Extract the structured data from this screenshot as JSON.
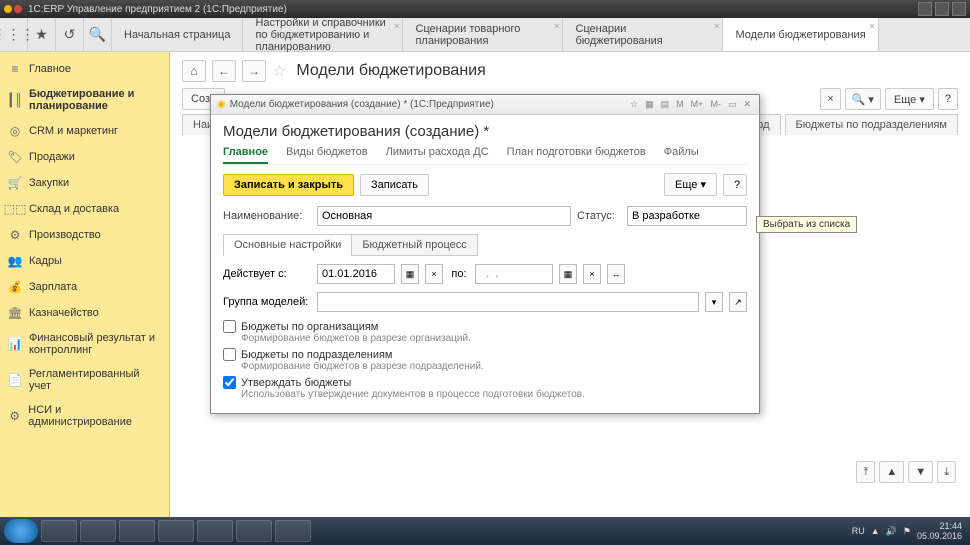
{
  "window": {
    "title": "1С:ERP Управление предприятием 2  (1С:Предприятие)"
  },
  "topTabs": {
    "t0": "Начальная страница",
    "t1": "Настройки и справочники по бюджетированию и планированию",
    "t2": "Сценарии товарного планирования",
    "t3": "Сценарии бюджетирования",
    "t4": "Модели бюджетирования"
  },
  "sidebar": {
    "s0": "Главное",
    "s1": "Бюджетирование и планирование",
    "s2": "CRM и маркетинг",
    "s3": "Продажи",
    "s4": "Закупки",
    "s5": "Склад и доставка",
    "s6": "Производство",
    "s7": "Кадры",
    "s8": "Зарплата",
    "s9": "Казначейство",
    "s10": "Финансовый результат и контроллинг",
    "s11": "Регламентированный учет",
    "s12": "НСИ и администрирование"
  },
  "page": {
    "title": "Модели бюджетирования",
    "createBtn": "Созд",
    "colName": "Наиме",
    "colPeriod": "ериод",
    "colBudgets": "Бюджеты по подразделениям",
    "moreBtn": "Еще ▾"
  },
  "modal": {
    "winTitle": "Модели бюджетирования (создание) * (1С:Предприятие)",
    "title": "Модели бюджетирования (создание) *",
    "tabs": {
      "t0": "Главное",
      "t1": "Виды бюджетов",
      "t2": "Лимиты расхода ДС",
      "t3": "План подготовки бюджетов",
      "t4": "Файлы"
    },
    "saveClose": "Записать и закрыть",
    "save": "Записать",
    "more": "Еще ▾",
    "q": "?",
    "nameLabel": "Наименование:",
    "nameValue": "Основная",
    "statusLabel": "Статус:",
    "statusValue": "В разработке",
    "subtabs": {
      "s0": "Основные настройки",
      "s1": "Бюджетный процесс"
    },
    "dateFromLabel": "Действует с:",
    "dateFrom": "01.01.2016",
    "dateToLabel": "по:",
    "groupLabel": "Группа моделей:",
    "chk1": "Бюджеты по организациям",
    "hint1": "Формирование бюджетов в разрезе организаций.",
    "chk2": "Бюджеты по подразделениям",
    "hint2": "Формирование бюджетов в разрезе подразделений.",
    "chk3": "Утверждать бюджеты",
    "hint3": "Использовать утверждение документов в процессе подготовки бюджетов."
  },
  "tooltip": "Выбрать из списка",
  "tray": {
    "lang": "RU",
    "time": "21:44",
    "date": "05.09.2016"
  }
}
